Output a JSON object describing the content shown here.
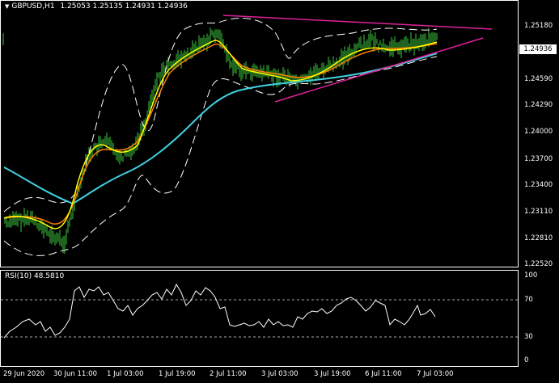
{
  "window": {
    "symbol_label": "GBPUSD,H1",
    "ohlc": "1.25053 1.25135 1.24931 1.24936",
    "current_price": "1.24936",
    "menu_arrow": "triangle-down-icon"
  },
  "price_axis": [
    "1.25180",
    "1.24890",
    "1.24590",
    "1.24290",
    "1.24000",
    "1.23700",
    "1.23400",
    "1.23110",
    "1.22810",
    "1.22520"
  ],
  "rsi": {
    "label": "RSI(10) 48.5810",
    "axis": [
      "100",
      "70",
      "30",
      "0"
    ]
  },
  "time_axis": [
    "29 Jun 2020",
    "30 Jun 11:00",
    "1 Jul 03:00",
    "1 Jul 19:00",
    "2 Jul 11:00",
    "3 Jul 03:00",
    "3 Jul 19:00",
    "6 Jul 11:00",
    "7 Jul 03:00"
  ],
  "colors": {
    "background": "#000000",
    "candles": "#3cc83c",
    "ema_fast": "#ffff00",
    "ema_mid": "#ff8000",
    "ema_slow": "#40d0e0",
    "trendlines": "#e0209a",
    "bands": "#ffffff",
    "rsi_line": "#ffffff"
  }
}
